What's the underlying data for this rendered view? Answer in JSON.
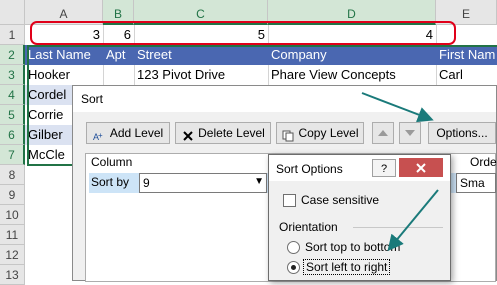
{
  "columns": [
    "A",
    "B",
    "C",
    "D",
    "E"
  ],
  "rows": [
    "1",
    "2",
    "3",
    "4",
    "5",
    "6",
    "7",
    "8",
    "9",
    "10",
    "11",
    "12",
    "13"
  ],
  "row1": {
    "a": "3",
    "b": "6",
    "c": "5",
    "d": "4"
  },
  "header_row": {
    "a": "Last Name",
    "b": "Apt",
    "c": "Street",
    "d": "Company",
    "e": "First Nam"
  },
  "data_rows": [
    {
      "a": "Hooker",
      "c": "123 Pivot Drive",
      "d": "Phare View Concepts",
      "e": "Carl"
    },
    {
      "a": "Cordel"
    },
    {
      "a": "Corrie"
    },
    {
      "a": "Gilber"
    },
    {
      "a": "McCle"
    }
  ],
  "sort_dialog": {
    "title": "Sort",
    "add_level": "Add Level",
    "delete_level": "Delete Level",
    "copy_level": "Copy Level",
    "options": "Options...",
    "column_header": "Column",
    "order_header": "Orde",
    "sort_by_label": "Sort by",
    "sort_by_value": "9",
    "order_value": "Sma"
  },
  "options_dialog": {
    "title": "Sort Options",
    "help": "?",
    "case_sensitive": "Case sensitive",
    "orientation": "Orientation",
    "top_to_bottom": "Sort top to bottom",
    "left_to_right": "Sort left to right",
    "selected": "left_to_right"
  },
  "colors": {
    "header_fill": "#4a67b1",
    "band_fill": "#dbe2f1",
    "highlight_ring": "#e0001a",
    "annotation_arrow": "#1a7a7a",
    "close_red": "#c75050"
  }
}
